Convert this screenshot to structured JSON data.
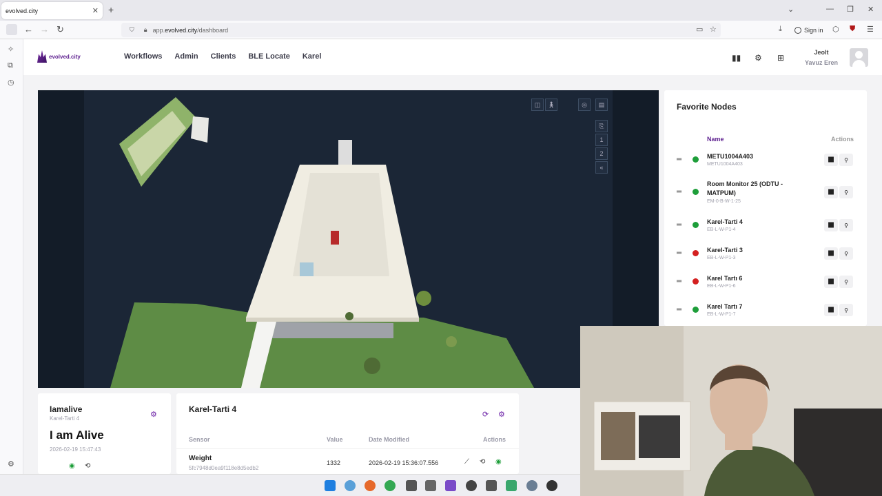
{
  "browser": {
    "tab_title": "evolved.city",
    "url_prefix": "app.",
    "url_domain": "evolved.city",
    "url_path": "/dashboard",
    "signin_label": "Sign in"
  },
  "app": {
    "logo_text": "evolved.city",
    "nav": [
      "Workflows",
      "Admin",
      "Clients",
      "BLE Locate",
      "Karel"
    ],
    "user_org": "Jeolt",
    "user_name": "Yavuz Eren"
  },
  "viewer": {
    "floors": [
      "1",
      "2"
    ]
  },
  "favorites": {
    "title": "Favorite Nodes",
    "col_name": "Name",
    "col_actions": "Actions",
    "items": [
      {
        "name": "METU1004A403",
        "id": "METU1004A403",
        "status": "online"
      },
      {
        "name": "Room Monitor 25 (ODTU - MATPUM)",
        "id": "EM-0-B-W-1-25",
        "status": "online"
      },
      {
        "name": "Karel-Tarti 4",
        "id": "EB-L-W-P1-4",
        "status": "online"
      },
      {
        "name": "Karel-Tarti 3",
        "id": "EB-L-W-P1-3",
        "status": "offline"
      },
      {
        "name": "Karel Tartı 6",
        "id": "EB-L-W-P1-6",
        "status": "offline"
      },
      {
        "name": "Karel Tartı 7",
        "id": "EB-L-W-P1-7",
        "status": "online"
      }
    ]
  },
  "alive_card": {
    "title": "Iamalive",
    "subtitle": "Karel-Tarti 4",
    "big_text": "I am Alive",
    "timestamp": "2026-02-19 15:47:43"
  },
  "sensor_card": {
    "title": "Karel-Tarti 4",
    "headers": {
      "sensor": "Sensor",
      "value": "Value",
      "date": "Date Modified",
      "actions": "Actions"
    },
    "rows": [
      {
        "sensor": "Weight",
        "id": "5fc7948d0ea9f118e8d5edb2",
        "value": "1332",
        "date": "2026-02-19 15:36:07.556"
      }
    ]
  },
  "colors": {
    "brand": "#5d1f8f",
    "online": "#1e9e3a",
    "offline": "#d42020",
    "viewer_bg": "#1b2636"
  }
}
